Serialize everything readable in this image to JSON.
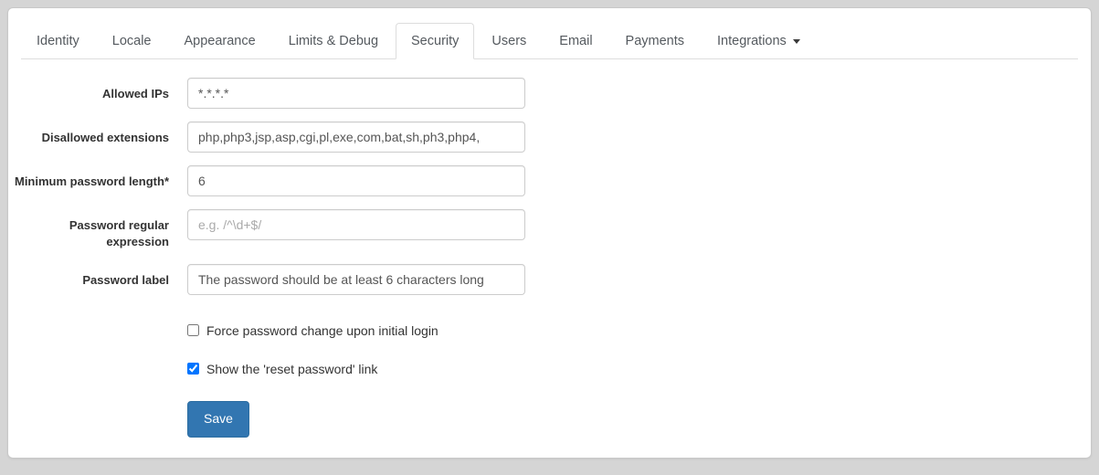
{
  "tabs": [
    {
      "label": "Identity",
      "active": false,
      "caret": false
    },
    {
      "label": "Locale",
      "active": false,
      "caret": false
    },
    {
      "label": "Appearance",
      "active": false,
      "caret": false
    },
    {
      "label": "Limits & Debug",
      "active": false,
      "caret": false
    },
    {
      "label": "Security",
      "active": true,
      "caret": false
    },
    {
      "label": "Users",
      "active": false,
      "caret": false
    },
    {
      "label": "Email",
      "active": false,
      "caret": false
    },
    {
      "label": "Payments",
      "active": false,
      "caret": false
    },
    {
      "label": "Integrations",
      "active": false,
      "caret": true
    }
  ],
  "form": {
    "fields": [
      {
        "label": "Allowed IPs",
        "value": "*.*.*.*",
        "placeholder": ""
      },
      {
        "label": "Disallowed extensions",
        "value": "php,php3,jsp,asp,cgi,pl,exe,com,bat,sh,ph3,php4,",
        "placeholder": ""
      },
      {
        "label": "Minimum password length*",
        "value": "6",
        "placeholder": ""
      },
      {
        "label": "Password regular expression",
        "value": "",
        "placeholder": "e.g. /^\\d+$/"
      },
      {
        "label": "Password label",
        "value": "The password should be at least 6 characters long",
        "placeholder": ""
      }
    ],
    "checkboxes": [
      {
        "label": "Force password change upon initial login",
        "checked": false
      },
      {
        "label": "Show the 'reset password' link",
        "checked": true
      }
    ],
    "save_label": "Save"
  },
  "colors": {
    "primary": "#3276b1",
    "border": "#cccccc",
    "tab_border": "#dddddd",
    "page_background": "#d5d5d5",
    "panel_background": "#ffffff",
    "text": "#333333",
    "placeholder": "#aaaaaa"
  }
}
